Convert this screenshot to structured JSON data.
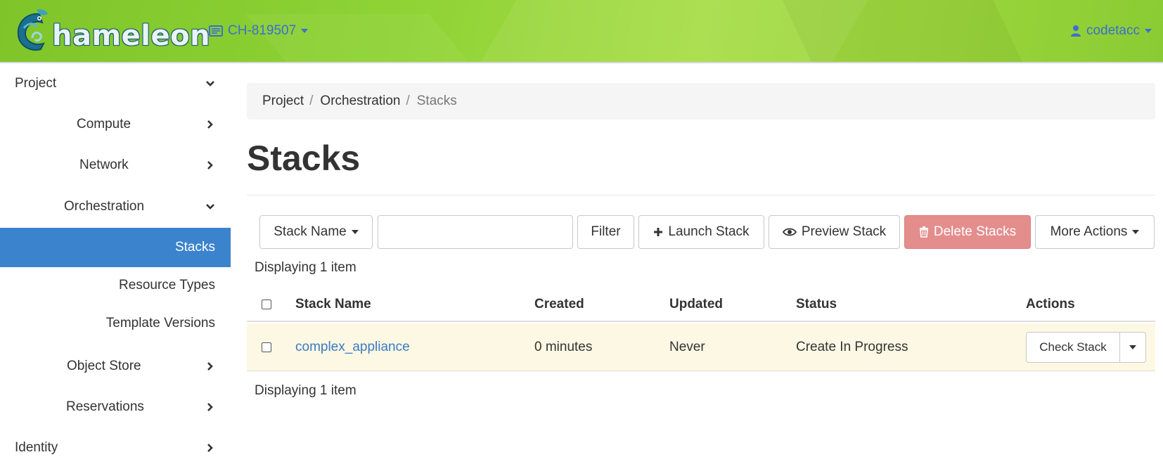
{
  "header": {
    "logo_text": "hameleon",
    "project": "CH-819507",
    "user": "codetacc"
  },
  "sidebar": {
    "project": "Project",
    "compute": "Compute",
    "network": "Network",
    "orchestration": "Orchestration",
    "stacks": "Stacks",
    "resource_types": "Resource Types",
    "template_versions": "Template Versions",
    "object_store": "Object Store",
    "reservations": "Reservations",
    "identity": "Identity"
  },
  "breadcrumb": {
    "items": [
      "Project",
      "Orchestration",
      "Stacks"
    ],
    "sep": "/"
  },
  "page": {
    "title": "Stacks"
  },
  "toolbar": {
    "filter_field": "Stack Name",
    "filter_value": "",
    "filter_button": "Filter",
    "launch": "Launch Stack",
    "preview": "Preview Stack",
    "delete": "Delete Stacks",
    "more": "More Actions"
  },
  "table": {
    "count_top": "Displaying 1 item",
    "count_bottom": "Displaying 1 item",
    "columns": [
      "Stack Name",
      "Created",
      "Updated",
      "Status",
      "Actions"
    ],
    "rows": [
      {
        "name": "complex_appliance",
        "created": "0 minutes",
        "updated": "Never",
        "status": "Create In Progress",
        "action": "Check Stack"
      }
    ]
  },
  "colors": {
    "header_green": "#8fd335",
    "accent_blue": "#3b83cd",
    "link_blue": "#3b7ac4",
    "danger": "#e48d8d",
    "row_highlight": "#fcf8e3"
  }
}
